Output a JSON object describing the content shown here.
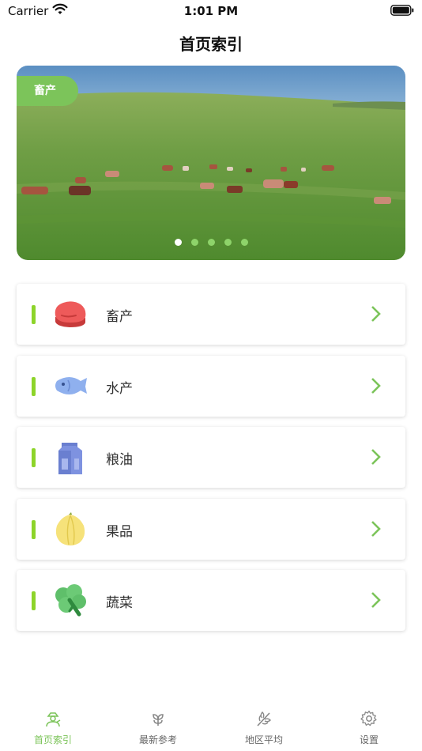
{
  "status_bar": {
    "carrier": "Carrier",
    "time": "1:01 PM"
  },
  "nav": {
    "title": "首页索引"
  },
  "banner": {
    "tag": "畜产",
    "page_count": 5,
    "active_index": 0
  },
  "categories": [
    {
      "label": "畜产",
      "icon": "meat-icon"
    },
    {
      "label": "水产",
      "icon": "fish-icon"
    },
    {
      "label": "粮油",
      "icon": "grain-oil-carton-icon"
    },
    {
      "label": "果品",
      "icon": "fruit-icon"
    },
    {
      "label": "蔬菜",
      "icon": "vegetable-icon"
    }
  ],
  "tab_bar": {
    "items": [
      {
        "label": "首页索引",
        "icon": "farmer-icon",
        "active": true
      },
      {
        "label": "最新参考",
        "icon": "sprout-icon",
        "active": false
      },
      {
        "label": "地区平均",
        "icon": "wheat-icon",
        "active": false
      },
      {
        "label": "设置",
        "icon": "gear-icon",
        "active": false
      }
    ]
  },
  "colors": {
    "accent_green": "#7cc45a",
    "bar_green": "#8dd42a",
    "tab_inactive": "#666666"
  }
}
